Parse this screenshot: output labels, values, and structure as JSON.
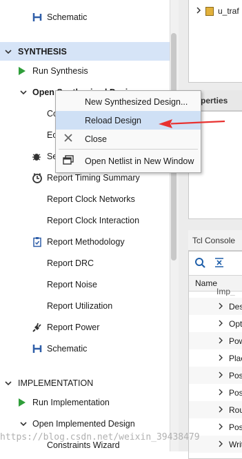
{
  "nav": {
    "top_item": "Schematic",
    "synthesis": {
      "title": "SYNTHESIS",
      "run": "Run Synthesis",
      "open": "Open Synthesized Design",
      "children": [
        "Constraints Wizard",
        "Edit Timing Constraints",
        "Set Up Debug"
      ],
      "partial_children": [
        "Co",
        "Ec",
        "Se"
      ],
      "reports": [
        "Report Timing Summary",
        "Report Clock Networks",
        "Report Clock Interaction",
        "Report Methodology",
        "Report DRC",
        "Report Noise",
        "Report Utilization",
        "Report Power",
        "Schematic"
      ]
    },
    "implementation": {
      "title": "IMPLEMENTATION",
      "run": "Run Implementation",
      "open": "Open Implemented Design",
      "child": "Constraints Wizard"
    }
  },
  "context_menu": {
    "items": [
      "New Synthesized Design...",
      "Reload Design",
      "Close",
      "Open Netlist in New Window"
    ]
  },
  "right": {
    "tree_item": "u_traf",
    "properties_tab": "Properties",
    "properties_tab_partial": "roperties",
    "tcl_tab": "Tcl Console",
    "name_header": "Name",
    "rows": [
      "Imp_",
      "Des",
      "Opt",
      "Pow",
      "Plac",
      "Pos",
      "Pos",
      "Rou",
      "Pos",
      "Writ"
    ]
  },
  "watermark": "https://blog.csdn.net/weixin_39438479",
  "colors": {
    "selected_row": "#d6e4f7",
    "menu_highlight": "#cfe0f5",
    "arrow": "#e8312f",
    "run_green": "#2f9e3a"
  }
}
